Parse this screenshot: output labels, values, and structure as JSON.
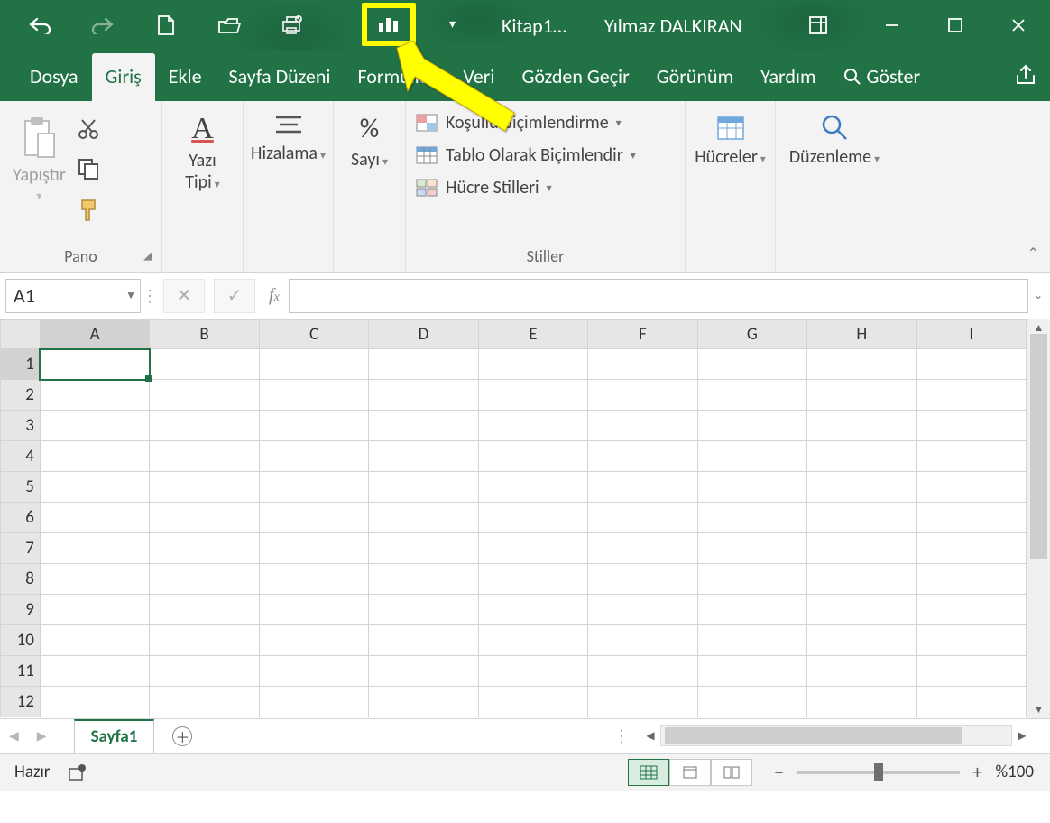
{
  "titlebar": {
    "doc_title": "Kitap1…",
    "user": "Yılmaz DALKIRAN"
  },
  "qat_icons": [
    "undo-icon",
    "redo-icon",
    "new-icon",
    "open-icon",
    "quickprint-icon",
    "chart-icon",
    "customize-icon"
  ],
  "tabs": {
    "file": "Dosya",
    "home": "Giriş",
    "insert": "Ekle",
    "layout": "Sayfa Düzeni",
    "formulas": "Formüller",
    "data": "Veri",
    "review": "Gözden Geçir",
    "view": "Görünüm",
    "help": "Yardım",
    "tellme": "Göster"
  },
  "ribbon": {
    "clipboard": {
      "paste": "Yapıştır",
      "group": "Pano"
    },
    "font": {
      "label": "Yazı Tipi"
    },
    "align": {
      "label": "Hizalama"
    },
    "number": {
      "label": "Sayı"
    },
    "styles": {
      "cond": "Koşullu Biçimlendirme",
      "table": "Tablo Olarak Biçimlendir",
      "cell": "Hücre Stilleri",
      "group": "Stiller"
    },
    "cells": {
      "label": "Hücreler"
    },
    "editing": {
      "label": "Düzenleme"
    }
  },
  "namebox": "A1",
  "columns": [
    "A",
    "B",
    "C",
    "D",
    "E",
    "F",
    "G",
    "H",
    "I"
  ],
  "rows": [
    "1",
    "2",
    "3",
    "4",
    "5",
    "6",
    "7",
    "8",
    "9",
    "10",
    "11",
    "12"
  ],
  "active_cell": {
    "row": 0,
    "col": 0
  },
  "sheet_tab": "Sayfa1",
  "status": "Hazır",
  "zoom_label": "%100"
}
